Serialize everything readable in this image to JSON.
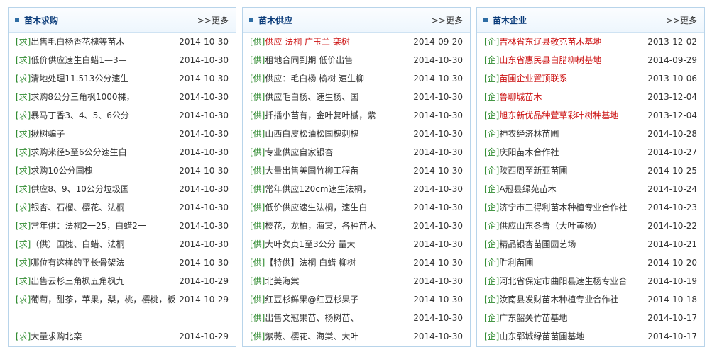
{
  "panels": [
    {
      "title": "苗木求购",
      "more": ">>更多",
      "items": [
        {
          "tag": "[求]",
          "text": "出售毛白杨香花槐等苗木",
          "date": "2014-10-30",
          "red": false
        },
        {
          "tag": "[求]",
          "text": "低价供应速生白蜡1—3—",
          "date": "2014-10-30",
          "red": false
        },
        {
          "tag": "[求]",
          "text": "清地处理11.513公分速生",
          "date": "2014-10-30",
          "red": false
        },
        {
          "tag": "[求]",
          "text": "求购8公分三角枫1000棵，",
          "date": "2014-10-30",
          "red": false
        },
        {
          "tag": "[求]",
          "text": "暴马丁香3、4、5、6公分",
          "date": "2014-10-30",
          "red": false
        },
        {
          "tag": "[求]",
          "text": "揪树骗子",
          "date": "2014-10-30",
          "red": false
        },
        {
          "tag": "[求]",
          "text": "求购米径5至6公分速生白",
          "date": "2014-10-30",
          "red": false
        },
        {
          "tag": "[求]",
          "text": "求购10公分国槐",
          "date": "2014-10-30",
          "red": false
        },
        {
          "tag": "[求]",
          "text": "供应8、9、10公分垃圾国",
          "date": "2014-10-30",
          "red": false
        },
        {
          "tag": "[求]",
          "text": "银杏、石榴、樱花、法桐",
          "date": "2014-10-30",
          "red": false
        },
        {
          "tag": "[求]",
          "text": "常年供：法桐2一25，白蜡2一",
          "date": "2014-10-30",
          "red": false
        },
        {
          "tag": "[求]",
          "text": "（供）国槐、白蜡、法桐",
          "date": "2014-10-30",
          "red": false
        },
        {
          "tag": "[求]",
          "text": "哪位有这样的平长骨架法",
          "date": "2014-10-30",
          "red": false
        },
        {
          "tag": "[求]",
          "text": "出售云杉三角枫五角枫九",
          "date": "2014-10-29",
          "red": false
        },
        {
          "tag": "[求]",
          "text": "葡萄，甜茶，苹果，梨，桃，樱桃，板",
          "date": "2014-10-29",
          "red": false,
          "tall": true
        },
        {
          "tag": "[求]",
          "text": "大量求购北栾",
          "date": "2014-10-29",
          "red": false
        }
      ]
    },
    {
      "title": "苗木供应",
      "more": ">>更多",
      "items": [
        {
          "tag": "[供]",
          "text": "供应 法桐 广玉兰 栾树",
          "date": "2014-09-20",
          "red": true
        },
        {
          "tag": "[供]",
          "text": "租地合同到期 低价出售",
          "date": "2014-10-30",
          "red": false
        },
        {
          "tag": "[供]",
          "text": "供应：毛白杨 榆树 速生柳",
          "date": "2014-10-30",
          "red": false
        },
        {
          "tag": "[供]",
          "text": "供应毛白杨、速生杨、国",
          "date": "2014-10-30",
          "red": false
        },
        {
          "tag": "[供]",
          "text": "扦插小苗有，金叶复叶槭，紫",
          "date": "2014-10-30",
          "red": false
        },
        {
          "tag": "[供]",
          "text": "山西白皮松油松国槐刺槐",
          "date": "2014-10-30",
          "red": false
        },
        {
          "tag": "[供]",
          "text": "专业供应自家银杏",
          "date": "2014-10-30",
          "red": false
        },
        {
          "tag": "[供]",
          "text": "大量出售美国竹柳工程苗",
          "date": "2014-10-30",
          "red": false
        },
        {
          "tag": "[供]",
          "text": "常年供应120cm速生法桐，",
          "date": "2014-10-30",
          "red": false
        },
        {
          "tag": "[供]",
          "text": "低价供应速生法桐，速生白",
          "date": "2014-10-30",
          "red": false
        },
        {
          "tag": "[供]",
          "text": "樱花，龙柏，海棠，各种苗木",
          "date": "2014-10-30",
          "red": false
        },
        {
          "tag": "[供]",
          "text": "大叶女贞1至3公分 量大",
          "date": "2014-10-30",
          "red": false
        },
        {
          "tag": "[供]",
          "text": "【特供】法桐 白蜡 柳树",
          "date": "2014-10-30",
          "red": false
        },
        {
          "tag": "[供]",
          "text": "北美海棠",
          "date": "2014-10-30",
          "red": false
        },
        {
          "tag": "[供]",
          "text": "红豆杉鲜果@红豆杉果子",
          "date": "2014-10-30",
          "red": false
        },
        {
          "tag": "[供]",
          "text": "出售文冠果苗、杨树苗、",
          "date": "2014-10-30",
          "red": false
        },
        {
          "tag": "[供]",
          "text": "紫薇、樱花、海棠、大叶",
          "date": "2014-10-30",
          "red": false
        }
      ]
    },
    {
      "title": "苗木企业",
      "more": ">>更多",
      "items": [
        {
          "tag": "[企]",
          "text": "吉林省东辽县敬克苗木基地",
          "date": "2013-12-02",
          "red": true
        },
        {
          "tag": "[企]",
          "text": "山东省惠民县白腊柳树基地",
          "date": "2014-09-29",
          "red": true
        },
        {
          "tag": "[企]",
          "text": "苗圃企业置顶联系",
          "date": "2013-10-06",
          "red": true
        },
        {
          "tag": "[企]",
          "text": "鲁聊城苗木",
          "date": "2013-12-04",
          "red": true
        },
        {
          "tag": "[企]",
          "text": "旭东新优品种萱草彩叶树种基地",
          "date": "2013-12-04",
          "red": true
        },
        {
          "tag": "[企]",
          "text": "神农经济林苗圃",
          "date": "2014-10-28",
          "red": false
        },
        {
          "tag": "[企]",
          "text": "庆阳苗木合作社",
          "date": "2014-10-27",
          "red": false
        },
        {
          "tag": "[企]",
          "text": "陕西周至新亚苗圃",
          "date": "2014-10-25",
          "red": false
        },
        {
          "tag": "[企]",
          "text": "A冠县绿苑苗木",
          "date": "2014-10-24",
          "red": false
        },
        {
          "tag": "[企]",
          "text": "济宁市三得利苗木种植专业合作社",
          "date": "2014-10-23",
          "red": false
        },
        {
          "tag": "[企]",
          "text": "供应山东冬青（大叶黄杨）",
          "date": "2014-10-22",
          "red": false
        },
        {
          "tag": "[企]",
          "text": "精品银杏苗圃园艺场",
          "date": "2014-10-21",
          "red": false
        },
        {
          "tag": "[企]",
          "text": "胜利苗圃",
          "date": "2014-10-20",
          "red": false
        },
        {
          "tag": "[企]",
          "text": "河北省保定市曲阳县速生杨专业合",
          "date": "2014-10-19",
          "red": false
        },
        {
          "tag": "[企]",
          "text": "汝南县发财苗木种植专业合作社",
          "date": "2014-10-18",
          "red": false
        },
        {
          "tag": "[企]",
          "text": "广东韶关竹苗基地",
          "date": "2014-10-17",
          "red": false
        },
        {
          "tag": "[企]",
          "text": "山东郓城绿苗苗圃基地",
          "date": "2014-10-17",
          "red": false
        }
      ]
    }
  ]
}
